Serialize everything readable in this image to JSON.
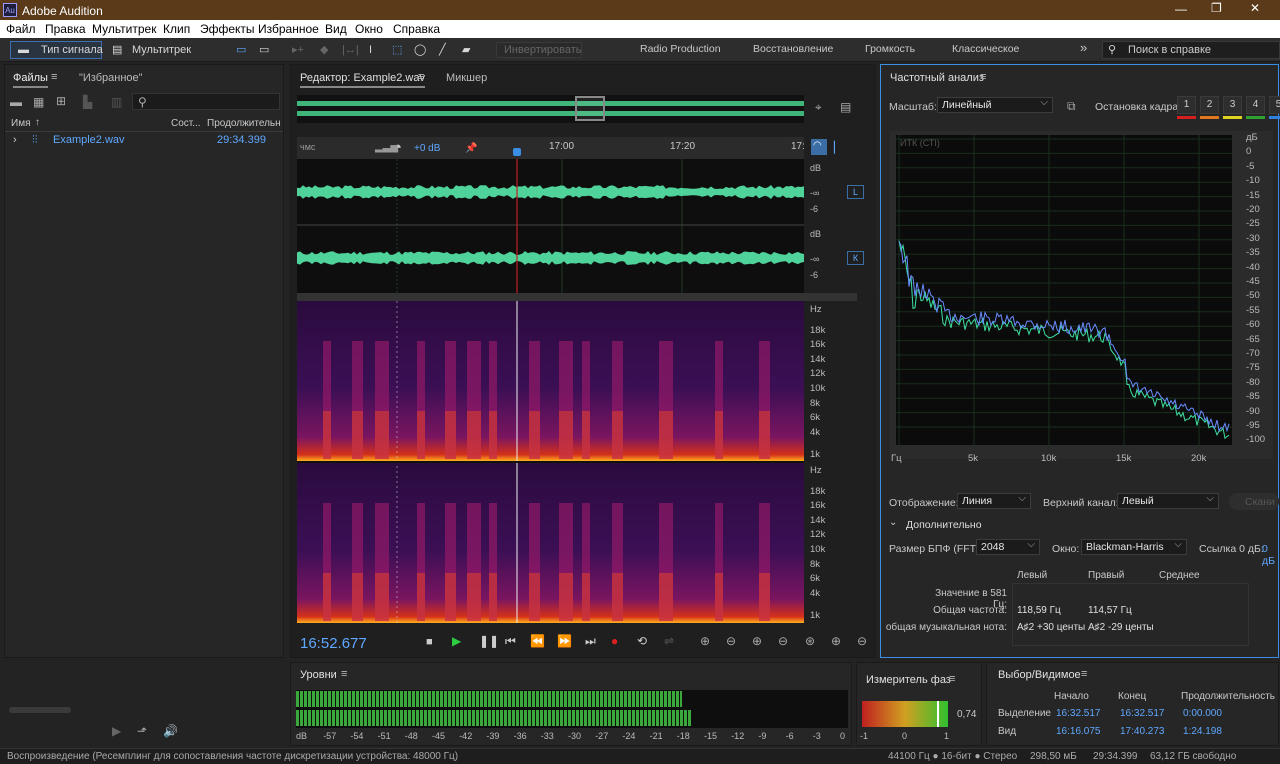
{
  "app": {
    "title": "Adobe Audition",
    "logo": "Au"
  },
  "menu": [
    "Файл",
    "Правка",
    "Мультитрек",
    "Клип",
    "Эффекты",
    "Избранное",
    "Вид",
    "Окно",
    "Справка"
  ],
  "toolbar": {
    "waveform_tab": "Тип сигнала",
    "multitrack_tab": "Мультитрек",
    "invert_btn": "Инвертировать",
    "workspaces": [
      "Radio Production",
      "Восстановление",
      "Громкость",
      "Классическое"
    ],
    "help_search": "Поиск в справке"
  },
  "files": {
    "tab_files": "Файлы",
    "tab_favorites": "\"Избранное\"",
    "col_name": "Имя",
    "col_status": "Сост...",
    "col_duration": "Продолжительн",
    "rows": [
      {
        "name": "Example2.wav",
        "duration": "29:34.399"
      }
    ]
  },
  "editor": {
    "tab_editor": "Редактор: Example2.wav",
    "tab_mixer": "Микшер",
    "ruler": {
      "unit": "чмс",
      "labels": [
        "17:00",
        "17:20",
        "17:"
      ]
    },
    "hud_gain": "+0 dB",
    "channels": [
      {
        "scale": [
          "dB",
          "-∞",
          "-6"
        ],
        "badge": "L"
      },
      {
        "scale": [
          "dB",
          "-∞",
          "-6"
        ],
        "badge": "К"
      }
    ],
    "spectral_scale": [
      "Hz",
      "18k",
      "16k",
      "14k",
      "12k",
      "10k",
      "8k",
      "6k",
      "4k",
      "1k"
    ],
    "time": "16:52.677"
  },
  "frequency": {
    "title": "Частотный анализ",
    "scale_label": "Масштаб:",
    "scale_value": "Линейный",
    "hold_label": "Остановка кадра:",
    "hold_buttons": [
      "1",
      "2",
      "3",
      "4",
      "5"
    ],
    "hold_colors": [
      "#d62020",
      "#e07820",
      "#e0d020",
      "#30a030",
      "#3080e0"
    ],
    "plot_label": "ИТК (СТІ)",
    "db_labels": [
      "дБ",
      "0",
      "-5",
      "-10",
      "-15",
      "-20",
      "-25",
      "-30",
      "-35",
      "-40",
      "-45",
      "-50",
      "-55",
      "-60",
      "-65",
      "-70",
      "-75",
      "-80",
      "-85",
      "-90",
      "-95",
      "-100"
    ],
    "hz_labels": [
      "Гц",
      "5k",
      "10k",
      "15k",
      "20k"
    ],
    "display_label": "Отображение:",
    "display_value": "Линия",
    "top_channel_label": "Верхний канал:",
    "top_channel_value": "Левый",
    "scan_btn": "Скани",
    "advanced": "Дополнительно",
    "fft_label": "Размер БПФ (FFT):",
    "fft_value": "2048",
    "window_label": "Окно:",
    "window_value": "Blackman-Harris",
    "ref_label": "Ссылка 0 дБ:",
    "ref_value": "0 дБ",
    "table": {
      "headers": [
        "Левый",
        "Правый",
        "Среднее"
      ],
      "rows": [
        {
          "label": "Значение в 581 Гц:",
          "values": [
            "",
            "",
            ""
          ]
        },
        {
          "label": "Общая частота:",
          "values": [
            "118,59 Гц",
            "114,57 Гц",
            ""
          ]
        },
        {
          "label": "общая музыкальная нота:",
          "values": [
            "A♯2 +30 центы",
            "A♯2 -29 центы",
            ""
          ]
        }
      ]
    }
  },
  "levels": {
    "title": "Уровни",
    "scale": [
      "dB",
      "-57",
      "-54",
      "-51",
      "-48",
      "-45",
      "-42",
      "-39",
      "-36",
      "-33",
      "-30",
      "-27",
      "-24",
      "-21",
      "-18",
      "-15",
      "-12",
      "-9",
      "-6",
      "-3",
      "0"
    ],
    "level_fraction": 0.7
  },
  "phase": {
    "title": "Измеритель фаз",
    "value": "0,74",
    "scale": [
      "-1",
      "0",
      "1"
    ]
  },
  "selection": {
    "title": "Выбор/Видимое",
    "headers": [
      "Начало",
      "Конец",
      "Продолжительность"
    ],
    "rows": [
      {
        "label": "Выделение",
        "values": [
          "16:32.517",
          "16:32.517",
          "0:00.000"
        ]
      },
      {
        "label": "Вид",
        "values": [
          "16:16.075",
          "17:40.273",
          "1:24.198"
        ]
      }
    ]
  },
  "status": {
    "left": "Воспроизведение (Ресемплинг для сопоставления частоте дискретизации устройства: 48000 Гц)",
    "format": "44100 Гц ● 16-бит ● Стерео",
    "size": "298,50 мБ",
    "duration": "29:34.399",
    "free": "63,12 ГБ свободно"
  }
}
